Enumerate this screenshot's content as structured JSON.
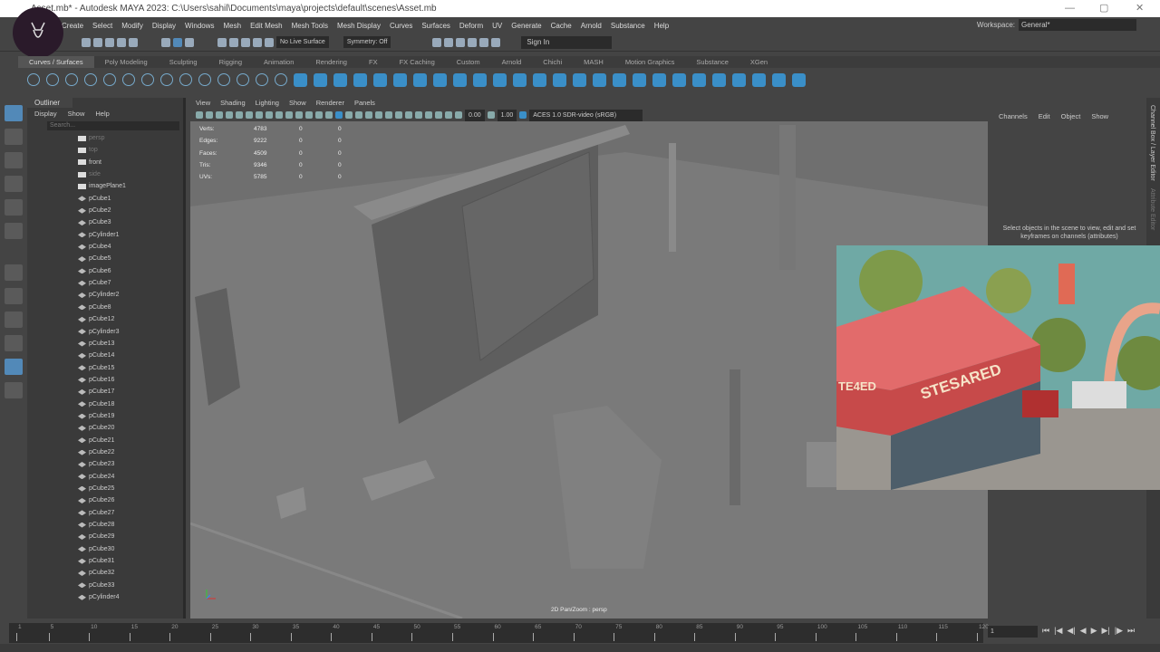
{
  "window": {
    "title": "Asset.mb* - Autodesk MAYA 2023: C:\\Users\\sahil\\Documents\\maya\\projects\\default\\scenes\\Asset.mb",
    "controls": [
      "—",
      "▢",
      "✕"
    ]
  },
  "menus": [
    "Create",
    "Select",
    "Modify",
    "Display",
    "Windows",
    "Mesh",
    "Edit Mesh",
    "Mesh Tools",
    "Mesh Display",
    "Curves",
    "Surfaces",
    "Deform",
    "UV",
    "Generate",
    "Cache",
    "Arnold",
    "Substance",
    "Help"
  ],
  "workspace": {
    "label": "Workspace:",
    "value": "General*"
  },
  "status": {
    "live_surface": "No Live Surface",
    "symmetry": "Symmetry: Off",
    "sign_in": "Sign In"
  },
  "shelf_tabs": [
    "Curves / Surfaces",
    "Poly Modeling",
    "Sculpting",
    "Rigging",
    "Animation",
    "Rendering",
    "FX",
    "FX Caching",
    "Custom",
    "Arnold",
    "Chichi",
    "MASH",
    "Motion Graphics",
    "Substance",
    "XGen"
  ],
  "outliner": {
    "tab": "Outliner",
    "menus": [
      "Display",
      "Show",
      "Help"
    ],
    "search_placeholder": "Search...",
    "items": [
      "persp",
      "top",
      "front",
      "side",
      "imagePlane1",
      "pCube1",
      "pCube2",
      "pCube3",
      "pCylinder1",
      "pCube4",
      "pCube5",
      "pCube6",
      "pCube7",
      "pCylinder2",
      "pCube8",
      "pCube12",
      "pCylinder3",
      "pCube13",
      "pCube14",
      "pCube15",
      "pCube16",
      "pCube17",
      "pCube18",
      "pCube19",
      "pCube20",
      "pCube21",
      "pCube22",
      "pCube23",
      "pCube24",
      "pCube25",
      "pCube26",
      "pCube27",
      "pCube28",
      "pCube29",
      "pCube30",
      "pCube31",
      "pCube32",
      "pCube33",
      "pCylinder4"
    ]
  },
  "viewport": {
    "menus": [
      "View",
      "Shading",
      "Lighting",
      "Show",
      "Renderer",
      "Panels"
    ],
    "exposure": "0.00",
    "gamma": "1.00",
    "color_space": "ACES 1.0 SDR-video (sRGB)",
    "hud": [
      [
        "Verts:",
        "4783",
        "0",
        "0"
      ],
      [
        "Edges:",
        "9222",
        "0",
        "0"
      ],
      [
        "Faces:",
        "4509",
        "0",
        "0"
      ],
      [
        "Tris:",
        "9346",
        "0",
        "0"
      ],
      [
        "UVs:",
        "5785",
        "0",
        "0"
      ]
    ],
    "camera_label": "2D Pan/Zoom : persp"
  },
  "channel_box": {
    "menus": [
      "Channels",
      "Edit",
      "Object",
      "Show"
    ],
    "message": "Select objects in the scene to view, edit and set keyframes on channels (attributes)"
  },
  "side_tabs": [
    "Channel Box / Layer Editor",
    "Attribute Editor"
  ],
  "inset": {
    "sign_text": "STESARED",
    "side_text": "TE4ED"
  },
  "timeline": {
    "ticks": [
      1,
      5,
      10,
      15,
      20,
      25,
      30,
      35,
      40,
      45,
      50,
      55,
      60,
      65,
      70,
      75,
      80,
      85,
      90,
      95,
      100,
      105,
      110,
      115,
      120
    ],
    "current_frame": "1"
  },
  "playback": [
    "⏮",
    "|◀",
    "◀|",
    "◀",
    "▶",
    "▶|",
    "|▶",
    "⏭"
  ]
}
